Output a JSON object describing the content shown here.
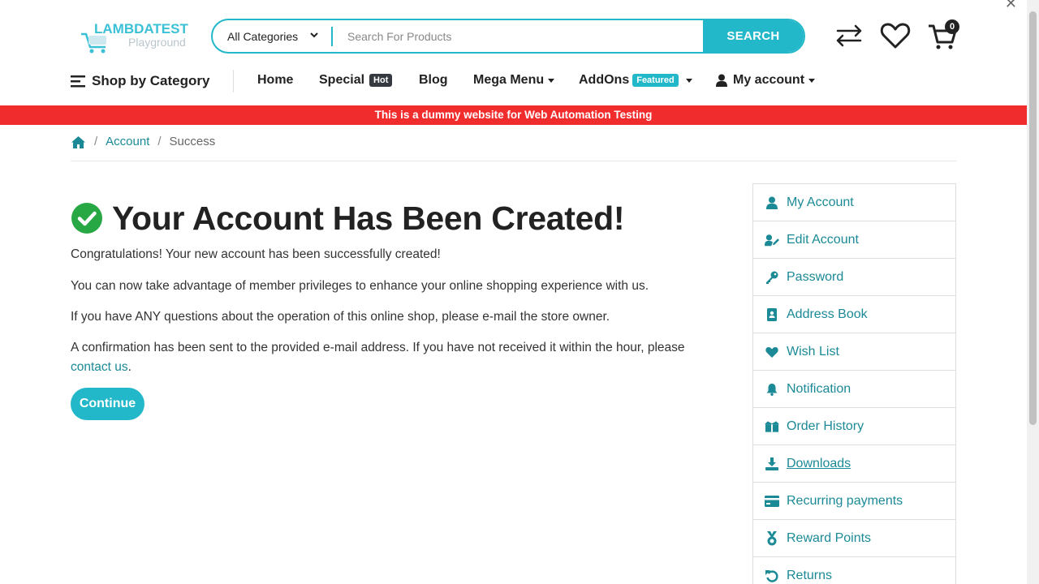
{
  "brand": {
    "name": "LAMBDATEST",
    "sub": "Playground"
  },
  "search": {
    "category": "All Categories",
    "placeholder": "Search For Products",
    "button": "SEARCH"
  },
  "header": {
    "cart_count": "0"
  },
  "nav": {
    "shop_by_category": "Shop by Category",
    "home": "Home",
    "special": "Special",
    "special_badge": "Hot",
    "blog": "Blog",
    "mega_menu": "Mega Menu",
    "addons": "AddOns",
    "addons_badge": "Featured",
    "my_account": "My account"
  },
  "banner": "This is a dummy website for Web Automation Testing",
  "breadcrumb": {
    "account": "Account",
    "current": "Success"
  },
  "main": {
    "title": "Your Account Has Been Created!",
    "p1": "Congratulations! Your new account has been successfully created!",
    "p2": "You can now take advantage of member privileges to enhance your online shopping experience with us.",
    "p3": "If you have ANY questions about the operation of this online shop, please e-mail the store owner.",
    "p4": "A confirmation has been sent to the provided e-mail address. If you have not received it within the hour, please",
    "contact_link": "contact us",
    "p4_end": ".",
    "continue": "Continue"
  },
  "sidebar": {
    "items": [
      {
        "label": "My Account",
        "icon": "user-icon"
      },
      {
        "label": "Edit Account",
        "icon": "user-edit-icon"
      },
      {
        "label": "Password",
        "icon": "key-icon"
      },
      {
        "label": "Address Book",
        "icon": "address-book-icon"
      },
      {
        "label": "Wish List",
        "icon": "heart-icon"
      },
      {
        "label": "Notification",
        "icon": "bell-icon"
      },
      {
        "label": "Order History",
        "icon": "boxes-icon"
      },
      {
        "label": "Downloads",
        "icon": "download-icon"
      },
      {
        "label": "Recurring payments",
        "icon": "credit-card-icon"
      },
      {
        "label": "Reward Points",
        "icon": "medal-icon"
      },
      {
        "label": "Returns",
        "icon": "undo-icon"
      }
    ]
  },
  "colors": {
    "accent": "#22b8c9",
    "link": "#1b8a96",
    "banner": "#f12c2c",
    "success": "#28a745"
  }
}
